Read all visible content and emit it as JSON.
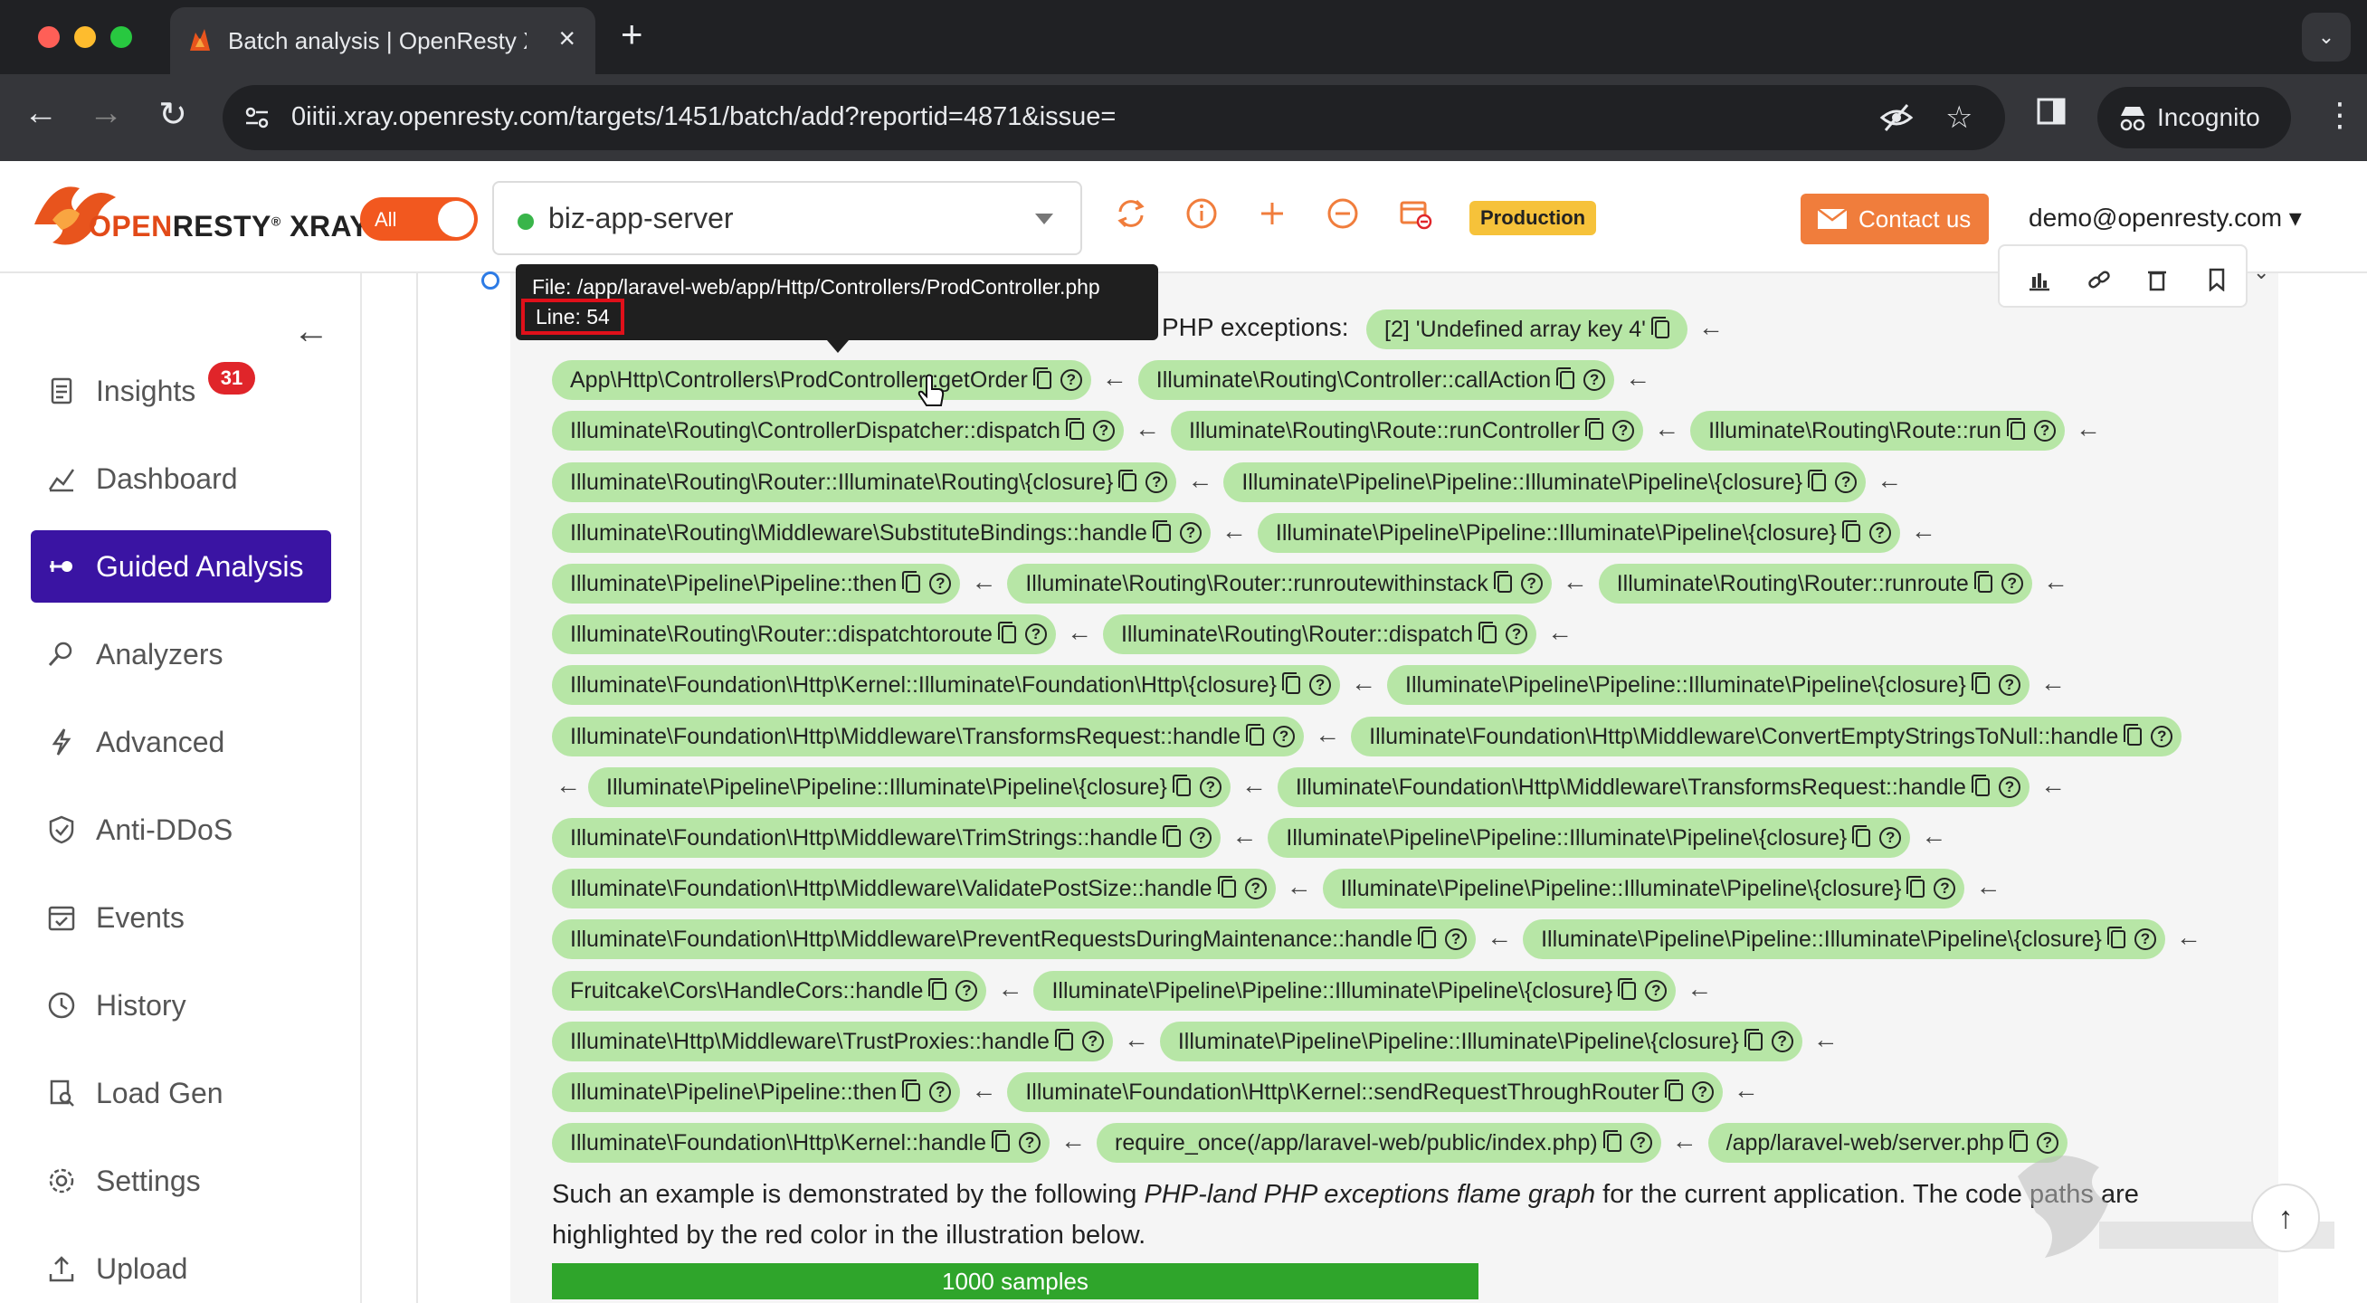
{
  "browser": {
    "tab_title": "Batch analysis | OpenResty XRay",
    "url": "0iitii.xray.openresty.com/targets/1451/batch/add?reportid=4871&issue=",
    "incognito_label": "Incognito"
  },
  "header": {
    "logo_open": "OPEN",
    "logo_resty": "RESTY",
    "logo_xray": "XRAY",
    "toggle_label": "All",
    "server_name": "biz-app-server",
    "env_badge": "Production",
    "contact_label": "Contact us",
    "user_email": "demo@openresty.com"
  },
  "sidebar": {
    "items": [
      {
        "label": "Insights",
        "icon": "insights-icon",
        "badge": "31"
      },
      {
        "label": "Dashboard",
        "icon": "dashboard-icon"
      },
      {
        "label": "Guided Analysis",
        "icon": "guided-analysis-icon",
        "active": true
      },
      {
        "label": "Analyzers",
        "icon": "analyzers-icon"
      },
      {
        "label": "Advanced",
        "icon": "advanced-icon"
      },
      {
        "label": "Anti-DDoS",
        "icon": "shield-icon"
      },
      {
        "label": "Events",
        "icon": "events-icon"
      },
      {
        "label": "History",
        "icon": "history-icon"
      },
      {
        "label": "Load Gen",
        "icon": "load-gen-icon"
      },
      {
        "label": "Settings",
        "icon": "gear-icon"
      },
      {
        "label": "Upload",
        "icon": "upload-icon"
      }
    ]
  },
  "tooltip": {
    "file": "File: /app/laravel-web/app/Http/Controllers/ProdController.php",
    "line": "Line: 54"
  },
  "content": {
    "intro_text": "PHP exceptions:",
    "rows": [
      [
        "[2] 'Undefined array key 4'"
      ],
      [
        "App\\Http\\Controllers\\ProdController::getOrder",
        "Illuminate\\Routing\\Controller::callAction"
      ],
      [
        "Illuminate\\Routing\\ControllerDispatcher::dispatch",
        "Illuminate\\Routing\\Route::runController",
        "Illuminate\\Routing\\Route::run"
      ],
      [
        "Illuminate\\Routing\\Router::Illuminate\\Routing\\{closure}",
        "Illuminate\\Pipeline\\Pipeline::Illuminate\\Pipeline\\{closure}"
      ],
      [
        "Illuminate\\Routing\\Middleware\\SubstituteBindings::handle",
        "Illuminate\\Pipeline\\Pipeline::Illuminate\\Pipeline\\{closure}"
      ],
      [
        "Illuminate\\Pipeline\\Pipeline::then",
        "Illuminate\\Routing\\Router::runroutewithinstack",
        "Illuminate\\Routing\\Router::runroute"
      ],
      [
        "Illuminate\\Routing\\Router::dispatchtoroute",
        "Illuminate\\Routing\\Router::dispatch"
      ],
      [
        "Illuminate\\Foundation\\Http\\Kernel::Illuminate\\Foundation\\Http\\{closure}",
        "Illuminate\\Pipeline\\Pipeline::Illuminate\\Pipeline\\{closure}"
      ],
      [
        "Illuminate\\Foundation\\Http\\Middleware\\TransformsRequest::handle",
        "Illuminate\\Foundation\\Http\\Middleware\\ConvertEmptyStringsToNull::handle"
      ],
      [
        "Illuminate\\Pipeline\\Pipeline::Illuminate\\Pipeline\\{closure}",
        "Illuminate\\Foundation\\Http\\Middleware\\TransformsRequest::handle"
      ],
      [
        "Illuminate\\Foundation\\Http\\Middleware\\TrimStrings::handle",
        "Illuminate\\Pipeline\\Pipeline::Illuminate\\Pipeline\\{closure}"
      ],
      [
        "Illuminate\\Foundation\\Http\\Middleware\\ValidatePostSize::handle",
        "Illuminate\\Pipeline\\Pipeline::Illuminate\\Pipeline\\{closure}"
      ],
      [
        "Illuminate\\Foundation\\Http\\Middleware\\PreventRequestsDuringMaintenance::handle",
        "Illuminate\\Pipeline\\Pipeline::Illuminate\\Pipeline\\{closure}"
      ],
      [
        "Fruitcake\\Cors\\HandleCors::handle",
        "Illuminate\\Pipeline\\Pipeline::Illuminate\\Pipeline\\{closure}"
      ],
      [
        "Illuminate\\Http\\Middleware\\TrustProxies::handle",
        "Illuminate\\Pipeline\\Pipeline::Illuminate\\Pipeline\\{closure}"
      ],
      [
        "Illuminate\\Pipeline\\Pipeline::then",
        "Illuminate\\Foundation\\Http\\Kernel::sendRequestThroughRouter"
      ],
      [
        "Illuminate\\Foundation\\Http\\Kernel::handle",
        "require_once(/app/laravel-web/public/index.php)",
        "/app/laravel-web/server.php"
      ]
    ],
    "para_1": "Such an example is demonstrated by the following ",
    "para_em": "PHP-land PHP exceptions flame graph",
    "para_2": " for the current application. The code paths are highlighted by the red color in the illustration below.",
    "samples": "1000 samples"
  },
  "colors": {
    "accent": "#3a14a3",
    "chip": "#b7e6a6",
    "brand_orange": "#f2581f",
    "badge_red": "#e0252a",
    "production": "#f6c23a",
    "samples_green": "#2fa52b"
  }
}
